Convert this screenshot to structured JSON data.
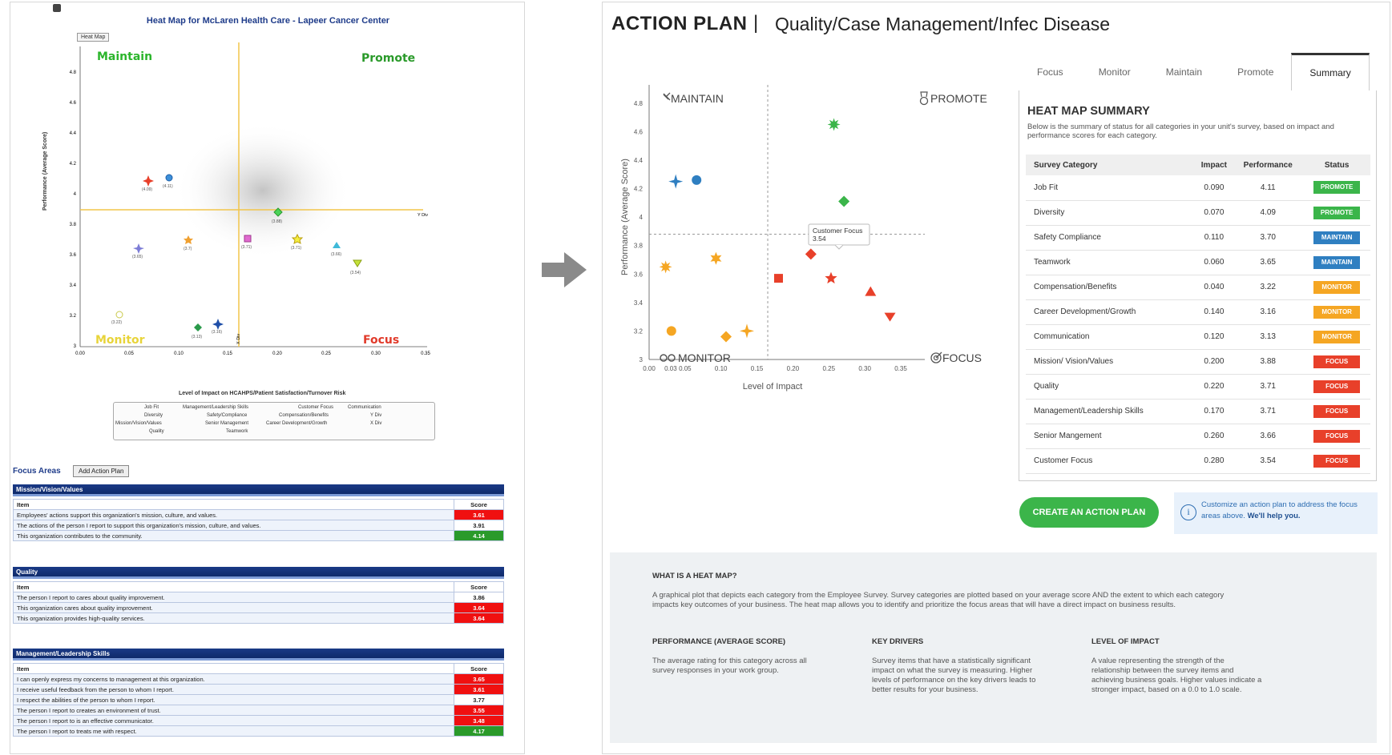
{
  "left": {
    "title": "Heat Map for McLaren Health Care - Lapeer Cancer Center",
    "tab": "Heat Map",
    "quadrants": {
      "maintain": "Maintain",
      "promote": "Promote",
      "monitor": "Monitor",
      "focus": "Focus"
    },
    "y_title": "Performance (Average Score)",
    "x_title": "Level of Impact on HCAHPS/Patient Satisfaction/Turnover Risk",
    "y_ticks": [
      "4.8",
      "4.6",
      "4.4",
      "4.2",
      "4",
      "3.8",
      "3.6",
      "3.4",
      "3.2",
      "3"
    ],
    "x_ticks": [
      "0.00",
      "0.05",
      "0.10",
      "0.15",
      "0.20",
      "0.25",
      "0.30",
      "0.35"
    ],
    "ydiv_label": "Y Div",
    "xdiv_label": "X Div",
    "point_labels": [
      "(4.09)",
      "(4.11)",
      "(3.88)",
      "(3.65)",
      "(3.7)",
      "(3.71)",
      "(3.71)",
      "(3.66)",
      "(3.54)",
      "(3.22)",
      "(3.13)",
      "(3.16)"
    ],
    "legend": [
      [
        "Job Fit",
        "Management/Leadership Skills",
        "Customer Focus",
        "Communication"
      ],
      [
        "Diversity",
        "Safety/Compliance",
        "Compensation/Benefits",
        "Y Div"
      ],
      [
        "Mission/Vision/Values",
        "Senior Management",
        "Career Development/Growth",
        "X Div"
      ],
      [
        "Quality",
        "Teamwork",
        "",
        ""
      ]
    ],
    "focus_areas": "Focus Areas",
    "add_action_plan": "Add Action Plan",
    "item_header": "Item",
    "score_header": "Score",
    "sections": [
      {
        "title": "Mission/Vision/Values",
        "rows": [
          {
            "item": "Employees' actions support this organization's mission, culture, and values.",
            "score": "3.61"
          },
          {
            "item": "The actions of the person I report to support this organization's mission, culture, and values.",
            "score": "3.91"
          },
          {
            "item": "This organization contributes to the community.",
            "score": "4.14"
          }
        ]
      },
      {
        "title": "Quality",
        "rows": [
          {
            "item": "The person I report to cares about quality improvement.",
            "score": "3.86"
          },
          {
            "item": "This organization cares about quality improvement.",
            "score": "3.64"
          },
          {
            "item": "This organization provides high-quality services.",
            "score": "3.64"
          }
        ]
      },
      {
        "title": "Management/Leadership Skills",
        "rows": [
          {
            "item": "I can openly express my concerns to management at this organization.",
            "score": "3.65"
          },
          {
            "item": "I receive useful feedback from the person to whom I report.",
            "score": "3.61"
          },
          {
            "item": "I respect the abilities of the person to whom I report.",
            "score": "3.77"
          },
          {
            "item": "The person I report to creates an environment of trust.",
            "score": "3.55"
          },
          {
            "item": "The person I report to is an effective communicator.",
            "score": "3.48"
          },
          {
            "item": "The person I report to treats me with respect.",
            "score": "4.17"
          }
        ]
      }
    ]
  },
  "right": {
    "title": "ACTION PLAN",
    "separator": "|",
    "subtitle": "Quality/Case Management/Infec Disease",
    "tabs": [
      "Focus",
      "Monitor",
      "Maintain",
      "Promote",
      "Summary"
    ],
    "active_tab": "Summary",
    "chart": {
      "quadrants": {
        "maintain": "MAINTAIN",
        "promote": "PROMOTE",
        "monitor": "MONITOR",
        "focus": "FOCUS"
      },
      "tooltip_title": "Customer Focus",
      "tooltip_value": "3.54"
    },
    "summary": {
      "title": "HEAT MAP SUMMARY",
      "description": "Below is the summary of status for all categories in your unit's survey, based on impact and performance scores for each category.",
      "headers": [
        "Survey Category",
        "Impact",
        "Performance",
        "Status"
      ],
      "rows": [
        {
          "category": "Job Fit",
          "impact": "0.090",
          "performance": "4.11",
          "status": "PROMOTE"
        },
        {
          "category": "Diversity",
          "impact": "0.070",
          "performance": "4.09",
          "status": "PROMOTE"
        },
        {
          "category": "Safety Compliance",
          "impact": "0.110",
          "performance": "3.70",
          "status": "MAINTAIN"
        },
        {
          "category": "Teamwork",
          "impact": "0.060",
          "performance": "3.65",
          "status": "MAINTAIN"
        },
        {
          "category": "Compensation/Benefits",
          "impact": "0.040",
          "performance": "3.22",
          "status": "MONITOR"
        },
        {
          "category": "Career Development/Growth",
          "impact": "0.140",
          "performance": "3.16",
          "status": "MONITOR"
        },
        {
          "category": "Communication",
          "impact": "0.120",
          "performance": "3.13",
          "status": "MONITOR"
        },
        {
          "category": "Mission/ Vision/Values",
          "impact": "0.200",
          "performance": "3.88",
          "status": "FOCUS"
        },
        {
          "category": "Quality",
          "impact": "0.220",
          "performance": "3.71",
          "status": "FOCUS"
        },
        {
          "category": "Management/Leadership Skills",
          "impact": "0.170",
          "performance": "3.71",
          "status": "FOCUS"
        },
        {
          "category": "Senior Mangement",
          "impact": "0.260",
          "performance": "3.66",
          "status": "FOCUS"
        },
        {
          "category": "Customer Focus",
          "impact": "0.280",
          "performance": "3.54",
          "status": "FOCUS"
        }
      ]
    },
    "status_colors": {
      "PROMOTE": "#3bb54a",
      "MAINTAIN": "#2f7fc1",
      "MONITOR": "#f5a623",
      "FOCUS": "#e8402a"
    },
    "cta_label": "CREATE AN ACTION PLAN",
    "help_text": "Customize an action plan to address the focus areas above.",
    "help_link": "We'll help you.",
    "info": {
      "what_title": "WHAT IS A HEAT MAP?",
      "what_text": "A graphical plot that depicts each category from the Employee Survey. Survey categories are plotted based on your average score AND the extent to which each category impacts key outcomes of your business. The heat map allows you to identify and prioritize the focus areas that will have a direct impact on business results.",
      "perf_title": "PERFORMANCE (AVERAGE SCORE)",
      "perf_text": "The average rating for this category across all survey responses in your work group.",
      "drivers_title": "KEY DRIVERS",
      "drivers_text": "Survey items that have a statistically significant impact on what the survey is measuring. Higher levels of performance on the key drivers leads to better results for your business.",
      "impact_title": "LEVEL OF IMPACT",
      "impact_text": "A value representing the strength of the relationship between the survey items and achieving business goals. Higher values indicate a stronger impact, based on a 0.0 to 1.0 scale."
    }
  },
  "chart_data": {
    "type": "scatter",
    "title": "",
    "xlabel": "Level of Impact",
    "ylabel": "Performance (Average Score)",
    "xlim": [
      0.0,
      0.35
    ],
    "ylim": [
      3.0,
      4.9
    ],
    "x_ticks": [
      "0.00",
      "0.03",
      "0.05",
      "0.10",
      "0.15",
      "0.20",
      "0.25",
      "0.30",
      "0.35"
    ],
    "y_ticks": [
      "3",
      "3.2",
      "3.4",
      "3.6",
      "3.8",
      "4",
      "4.2",
      "4.4",
      "4.6",
      "4.8"
    ],
    "x_divider": 0.165,
    "y_divider": 3.88,
    "points": [
      {
        "x": 0.037,
        "y": 4.25,
        "shape": "star4",
        "color": "#2f7fc1"
      },
      {
        "x": 0.066,
        "y": 4.26,
        "shape": "circle",
        "color": "#2f7fc1"
      },
      {
        "x": 0.257,
        "y": 4.65,
        "shape": "star8",
        "color": "#3bb54a"
      },
      {
        "x": 0.271,
        "y": 4.11,
        "shape": "diamond",
        "color": "#3bb54a"
      },
      {
        "x": 0.023,
        "y": 3.65,
        "shape": "star8",
        "color": "#f5a623"
      },
      {
        "x": 0.093,
        "y": 3.71,
        "shape": "star6",
        "color": "#f5a623"
      },
      {
        "x": 0.031,
        "y": 3.2,
        "shape": "circle",
        "color": "#f5a623"
      },
      {
        "x": 0.107,
        "y": 3.16,
        "shape": "diamond",
        "color": "#f5a623"
      },
      {
        "x": 0.136,
        "y": 3.2,
        "shape": "star4",
        "color": "#f5a623"
      },
      {
        "x": 0.225,
        "y": 3.74,
        "shape": "diamond",
        "color": "#e8402a"
      },
      {
        "x": 0.18,
        "y": 3.57,
        "shape": "square",
        "color": "#e8402a"
      },
      {
        "x": 0.253,
        "y": 3.57,
        "shape": "star5",
        "color": "#e8402a"
      },
      {
        "x": 0.308,
        "y": 3.48,
        "shape": "triangle",
        "color": "#e8402a"
      },
      {
        "x": 0.335,
        "y": 3.3,
        "shape": "triangle-down",
        "color": "#e8402a"
      }
    ]
  }
}
